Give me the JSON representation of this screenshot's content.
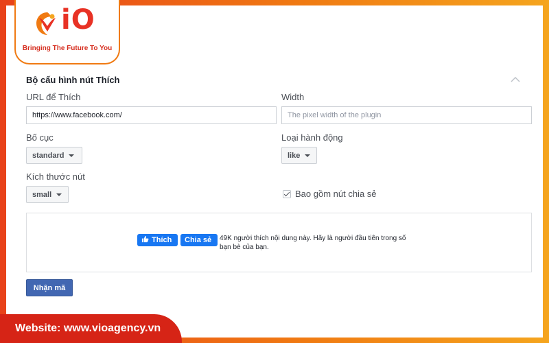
{
  "brand": {
    "logo_text": "iO",
    "tagline": "Bringing The Future To You"
  },
  "section": {
    "title": "Bộ cấu hình nút Thích"
  },
  "fields": {
    "url_label": "URL để Thích",
    "url_value": "https://www.facebook.com/",
    "width_label": "Width",
    "width_placeholder": "The pixel width of the plugin",
    "layout_label": "Bố cục",
    "layout_value": "standard",
    "action_label": "Loại hành động",
    "action_value": "like",
    "size_label": "Kích thước nút",
    "size_value": "small",
    "share_label": "Bao gồm nút chia sẻ",
    "share_checked": true
  },
  "preview": {
    "like_label": "Thích",
    "share_label": "Chia sẻ",
    "text": "49K người thích nội dung này. Hãy là người đầu tiên trong số bạn bè của bạn."
  },
  "submit_label": "Nhận mã",
  "footer": {
    "website": "Website: www.vioagency.vn"
  },
  "colors": {
    "frame_start": "#e8421a",
    "frame_end": "#f5a51e",
    "facebook_blue": "#1877f2",
    "submit_blue": "#4267b2",
    "footer_red": "#d62416"
  }
}
